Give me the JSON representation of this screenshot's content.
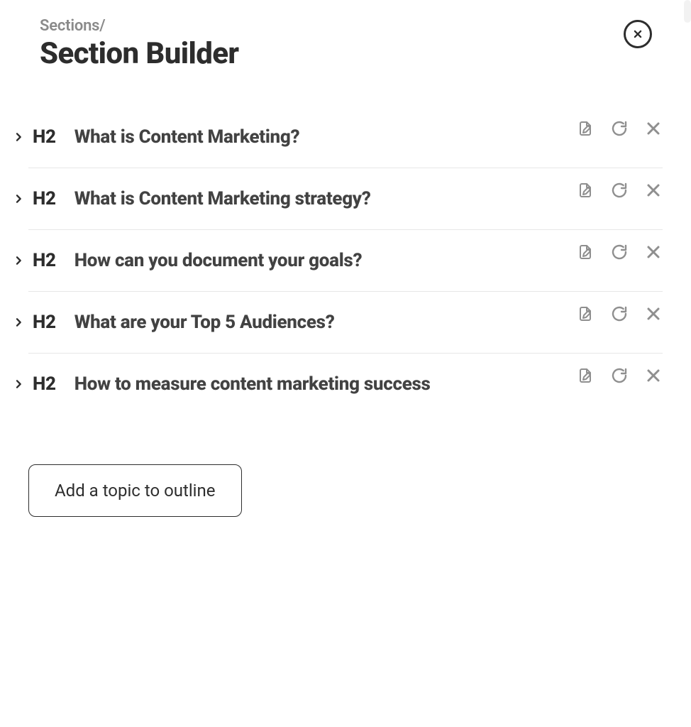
{
  "breadcrumb": "Sections/",
  "pageTitle": "Section Builder",
  "headingLevel": "H2",
  "rows": [
    {
      "title": "What is Content Marketing?"
    },
    {
      "title": "What is Content Marketing strategy?"
    },
    {
      "title": "How can you document your goals?"
    },
    {
      "title": "What are your Top 5 Audiences?"
    },
    {
      "title": "How to measure content marketing success"
    }
  ],
  "addButton": "Add a topic to outline"
}
